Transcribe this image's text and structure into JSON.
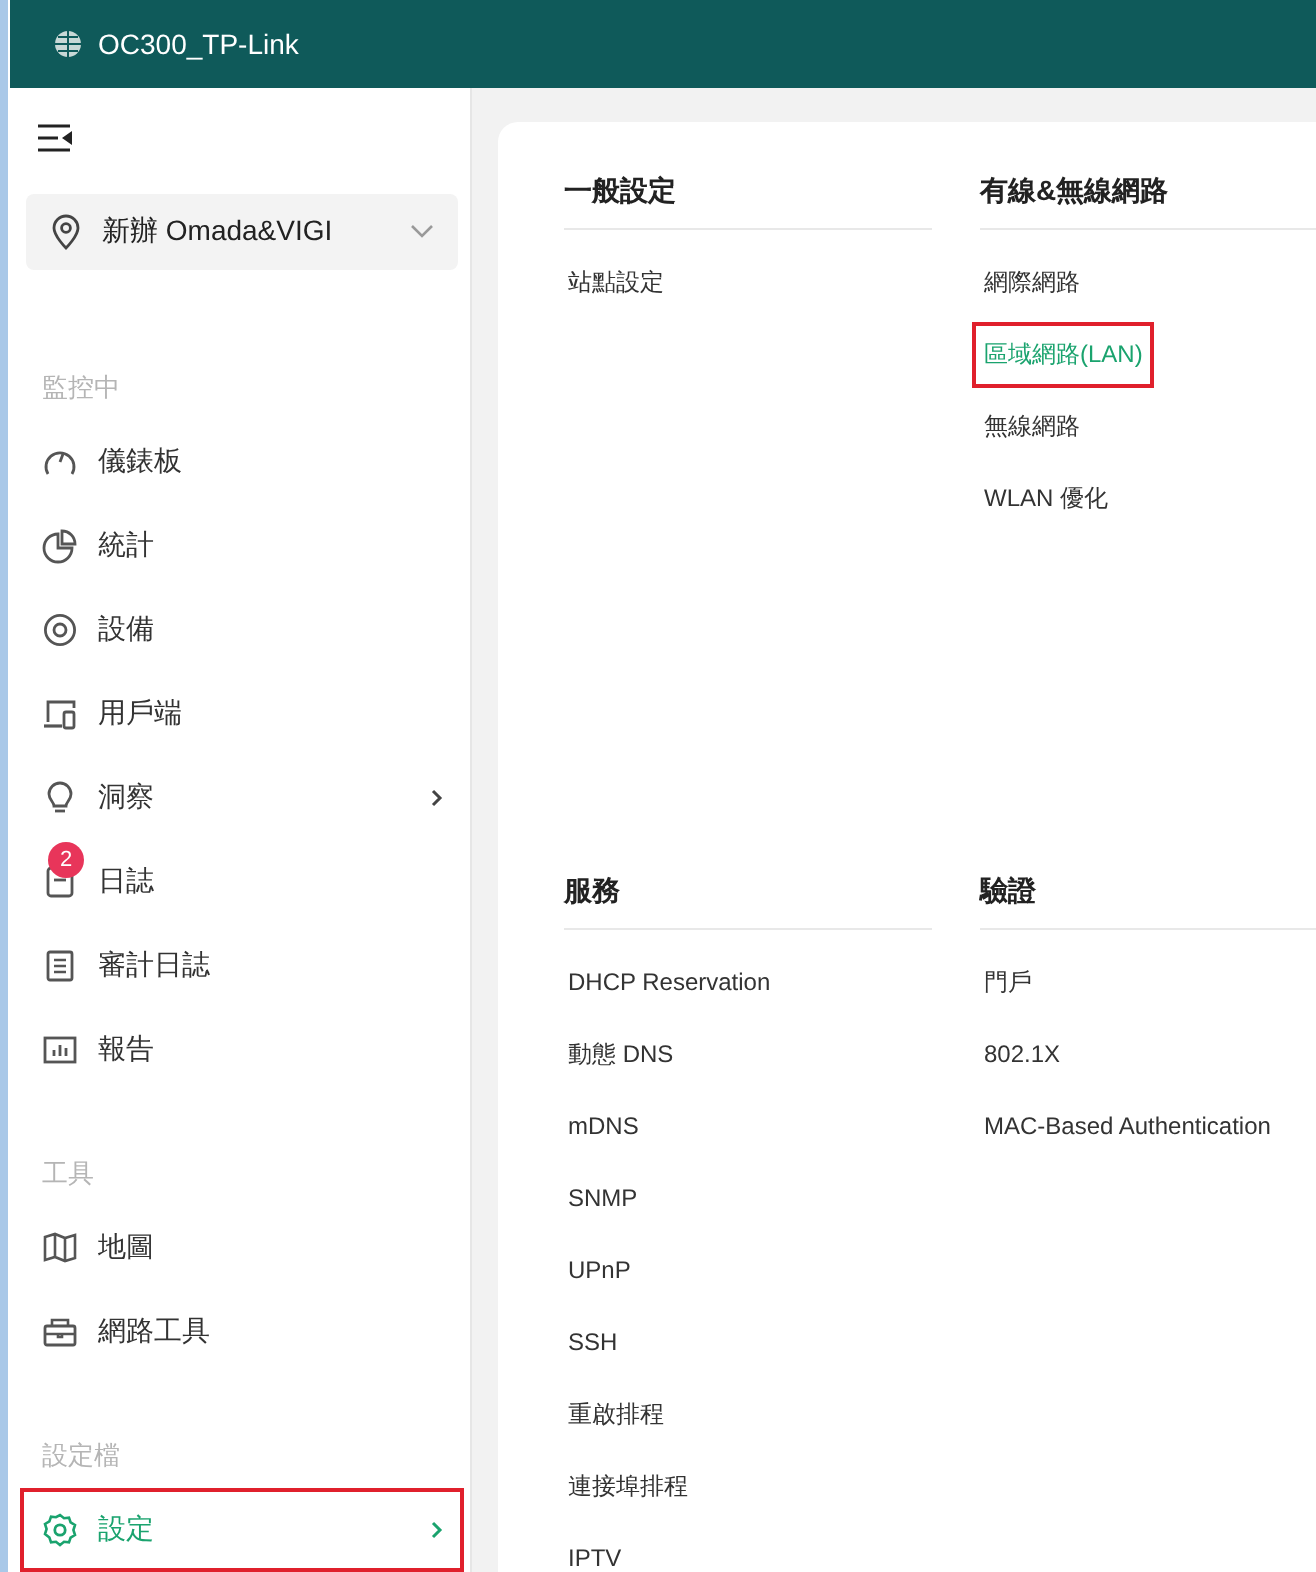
{
  "header": {
    "title": "OC300_TP-Link"
  },
  "site_selector": {
    "value": "新辦 Omada&VIGI"
  },
  "sidebar": {
    "sections": [
      {
        "title": "監控中",
        "items": [
          {
            "label": "儀錶板",
            "kind": "gauge",
            "selected": false,
            "highlighted": false,
            "expandable": false
          },
          {
            "label": "統計",
            "kind": "pie",
            "selected": false,
            "highlighted": false,
            "expandable": false
          },
          {
            "label": "設備",
            "kind": "target",
            "selected": false,
            "highlighted": false,
            "expandable": false
          },
          {
            "label": "用戶端",
            "kind": "devices",
            "selected": false,
            "highlighted": false,
            "expandable": false
          },
          {
            "label": "洞察",
            "kind": "bulb",
            "selected": false,
            "highlighted": false,
            "expandable": true
          },
          {
            "label": "日誌",
            "kind": "log",
            "selected": false,
            "highlighted": false,
            "expandable": false,
            "badge": "2"
          },
          {
            "label": "審計日誌",
            "kind": "list",
            "selected": false,
            "highlighted": false,
            "expandable": false
          },
          {
            "label": "報告",
            "kind": "chart",
            "selected": false,
            "highlighted": false,
            "expandable": false
          }
        ]
      },
      {
        "title": "工具",
        "items": [
          {
            "label": "地圖",
            "kind": "map",
            "selected": false,
            "highlighted": false,
            "expandable": false
          },
          {
            "label": "網路工具",
            "kind": "toolbox",
            "selected": false,
            "highlighted": false,
            "expandable": false
          }
        ]
      },
      {
        "title": "設定檔",
        "items": [
          {
            "label": "設定",
            "kind": "gear",
            "selected": true,
            "highlighted": true,
            "expandable": true
          }
        ]
      }
    ]
  },
  "settings_groups": [
    {
      "title": "一般設定",
      "links": [
        {
          "label": "站點設定",
          "selected": false,
          "highlighted": false
        }
      ]
    },
    {
      "title": "有線&無線網路",
      "links": [
        {
          "label": "網際網路",
          "selected": false,
          "highlighted": false
        },
        {
          "label": "區域網路(LAN)",
          "selected": true,
          "highlighted": true
        },
        {
          "label": "無線網路",
          "selected": false,
          "highlighted": false
        },
        {
          "label": "WLAN 優化",
          "selected": false,
          "highlighted": false
        }
      ]
    },
    {
      "title": "服務",
      "links": [
        {
          "label": "DHCP Reservation",
          "selected": false,
          "highlighted": false
        },
        {
          "label": "動態 DNS",
          "selected": false,
          "highlighted": false
        },
        {
          "label": "mDNS",
          "selected": false,
          "highlighted": false
        },
        {
          "label": "SNMP",
          "selected": false,
          "highlighted": false
        },
        {
          "label": "UPnP",
          "selected": false,
          "highlighted": false
        },
        {
          "label": "SSH",
          "selected": false,
          "highlighted": false
        },
        {
          "label": "重啟排程",
          "selected": false,
          "highlighted": false
        },
        {
          "label": "連接埠排程",
          "selected": false,
          "highlighted": false
        },
        {
          "label": "IPTV",
          "selected": false,
          "highlighted": false
        }
      ]
    },
    {
      "title": "驗證",
      "links": [
        {
          "label": "門戶",
          "selected": false,
          "highlighted": false
        },
        {
          "label": "802.1X",
          "selected": false,
          "highlighted": false
        },
        {
          "label": "MAC-Based Authentication",
          "selected": false,
          "highlighted": false
        }
      ]
    }
  ]
}
